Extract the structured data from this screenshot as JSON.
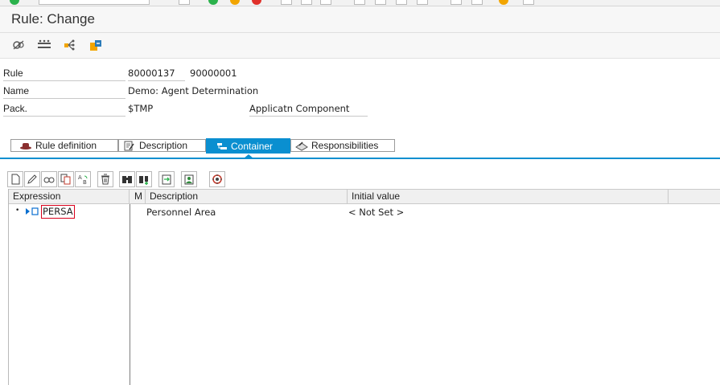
{
  "window": {
    "title": "Rule: Change"
  },
  "app_toolbar": {
    "icons": [
      "display-change-icon",
      "structure-icon",
      "hierarchy-icon",
      "transport-icon"
    ]
  },
  "header": {
    "rule_label": "Rule",
    "rule_value": "80000137",
    "rule_value2": "90000001",
    "name_label": "Name",
    "name_value": "Demo: Agent Determination",
    "package_label": "Pack.",
    "package_value": "$TMP",
    "component_label": "Applicatn Component"
  },
  "tabs": [
    {
      "label": "Rule definition",
      "icon": "hat-icon"
    },
    {
      "label": "Description",
      "icon": "document-pencil-icon"
    },
    {
      "label": "Container",
      "icon": "container-icon",
      "active": true
    },
    {
      "label": "Responsibilities",
      "icon": "responsibilities-icon"
    }
  ],
  "container_toolbar": {
    "icons": [
      "create-icon",
      "edit-icon",
      "display-icon",
      "copy-icon",
      "rename-icon",
      "delete-icon",
      "find-icon",
      "find-next-icon",
      "import-icon",
      "user-icon",
      "bindings-icon"
    ]
  },
  "grid": {
    "columns": {
      "expression": "Expression",
      "m": "M",
      "description": "Description",
      "initial_value": "Initial value"
    },
    "rows": [
      {
        "expression": "PERSA",
        "description": "Personnel Area",
        "initial_value": "< Not Set >"
      }
    ]
  },
  "colors": {
    "accent": "#0a8fd0",
    "selection_border": "#d9001b"
  }
}
